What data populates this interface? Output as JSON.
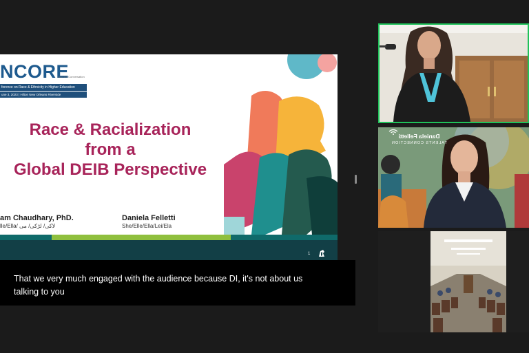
{
  "slide": {
    "logo": "NCORE",
    "tagline": "Join the Conversation",
    "conference_line": "ference on Race & Ethnicity in Higher Education",
    "date_line": "une 3, 2023 | Hilton New Orleans Riverside",
    "title_lines": [
      "Race & Racialization",
      "from a",
      "Global DEIB Perspective"
    ],
    "presenter1_name": "am Chaudhary, PhD.",
    "presenter1_pronouns": "lle/Ella/ لاکی/ لڑکی/ می",
    "presenter2_name": "Daniela Felletti",
    "presenter2_pronouns": "She/Elle/Ella/Lei/Ela",
    "page_number": "1"
  },
  "caption": {
    "text": "That we very much engaged with the audience because DI, it's not about us talking to you"
  },
  "participants": [
    {
      "label": "speaker-video",
      "active": true
    },
    {
      "label": "daniela-felletti-video",
      "bg_title": "Daniela Felletti",
      "bg_subtitle": "TALENTS CONNECTION"
    },
    {
      "label": "conference-room-video"
    }
  ],
  "colors": {
    "active_speaker_border": "#1fc25a",
    "title": "#a8245a",
    "logo": "#1e5a8e",
    "band_dark": "#0f6a6a",
    "band_light": "#8fbf3e",
    "band_bottom": "#123f46",
    "background": "#1b1b1b"
  }
}
